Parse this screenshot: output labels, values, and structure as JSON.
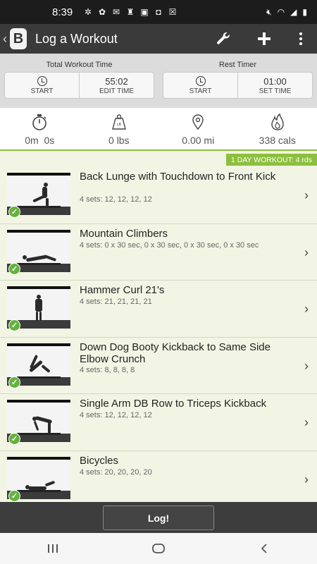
{
  "status_bar": {
    "time": "8:39"
  },
  "app_bar": {
    "title": "Log a Workout",
    "logo_letter": "B"
  },
  "timers": {
    "total": {
      "title": "Total Workout Time",
      "start_label": "START",
      "time_value": "55:02",
      "edit_label": "EDIT TIME"
    },
    "rest": {
      "title": "Rest Timer",
      "start_label": "START",
      "time_value": "01:00",
      "set_label": "SET TIME"
    }
  },
  "stats": {
    "duration": "0m  0s",
    "weight": "0 lbs",
    "distance": "0.00 mi",
    "calories": "338 cals"
  },
  "round_badge": "1 DAY WORKOUT: 4 rds",
  "exercises": [
    {
      "name": "Back Lunge with Touchdown to Front Kick",
      "sets": "4 sets: 12, 12, 12, 12"
    },
    {
      "name": "Mountain Climbers",
      "sets": "4 sets: 0 x 30 sec, 0 x 30 sec, 0 x 30 sec, 0 x 30 sec"
    },
    {
      "name": "Hammer Curl 21's",
      "sets": "4 sets: 21, 21, 21, 21"
    },
    {
      "name": "Down Dog Booty Kickback to Same Side Elbow Crunch",
      "sets": "4 sets: 8, 8, 8, 8"
    },
    {
      "name": "Single Arm DB Row to Triceps Kickback",
      "sets": "4 sets: 12, 12, 12, 12"
    },
    {
      "name": "Bicycles",
      "sets": "4 sets: 20, 20, 20, 20"
    }
  ],
  "log_button": "Log!",
  "colors": {
    "accent": "#8dbf3f",
    "check": "#64b33c",
    "appbar": "#3a3a3a",
    "list_bg": "#f2f5e4"
  }
}
